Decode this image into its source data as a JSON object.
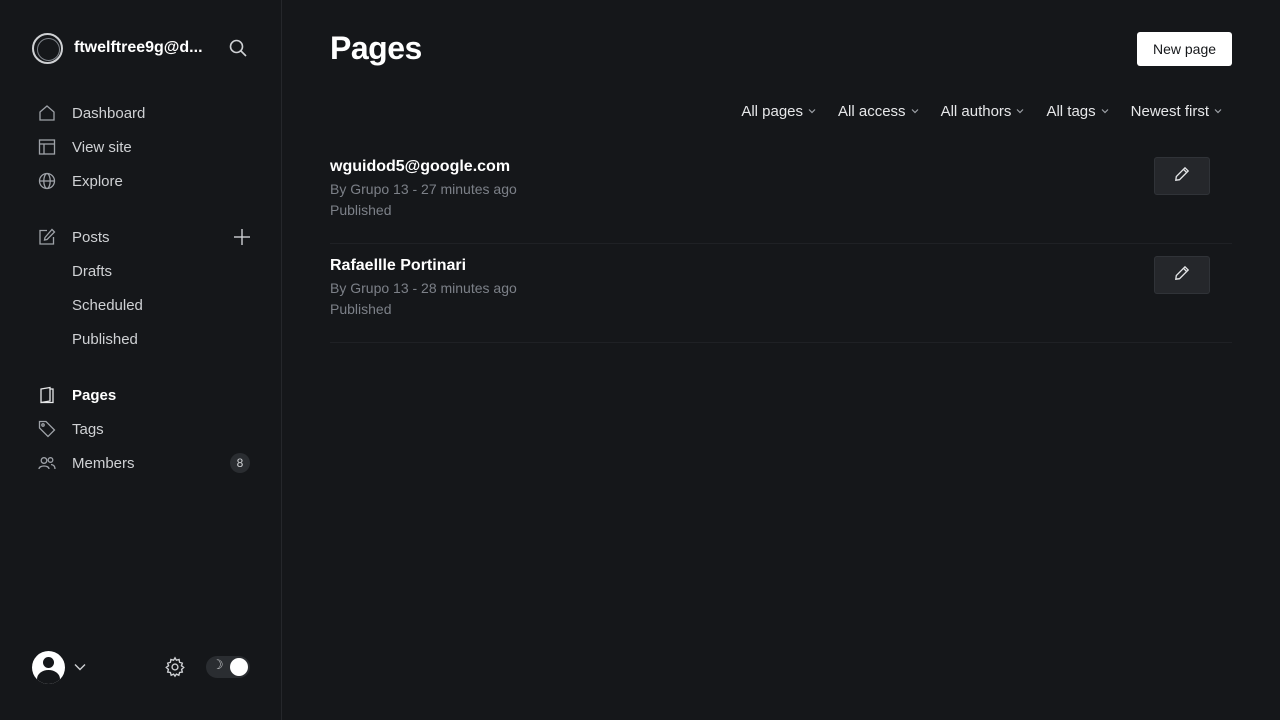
{
  "site": {
    "title": "ftwelftree9g@d..."
  },
  "nav": {
    "dashboard": "Dashboard",
    "view_site": "View site",
    "explore": "Explore",
    "posts": "Posts",
    "drafts": "Drafts",
    "scheduled": "Scheduled",
    "published": "Published",
    "pages": "Pages",
    "tags": "Tags",
    "members": "Members",
    "members_count": "8"
  },
  "footer": {
    "theme_icon": "☽"
  },
  "main": {
    "title": "Pages",
    "new_page_label": "New page",
    "filters": [
      "All pages",
      "All access",
      "All authors",
      "All tags",
      "Newest first"
    ]
  },
  "pages": [
    {
      "title": "wguidod5@google.com",
      "meta": "By Grupo 13 - 27 minutes ago",
      "status": "Published"
    },
    {
      "title": "Rafaellle Portinari",
      "meta": "By Grupo 13 - 28 minutes ago",
      "status": "Published"
    }
  ],
  "colors": {
    "background": "#15171a",
    "text": "#ffffff",
    "muted": "#7c8088",
    "accent_button": "#ffffff"
  }
}
